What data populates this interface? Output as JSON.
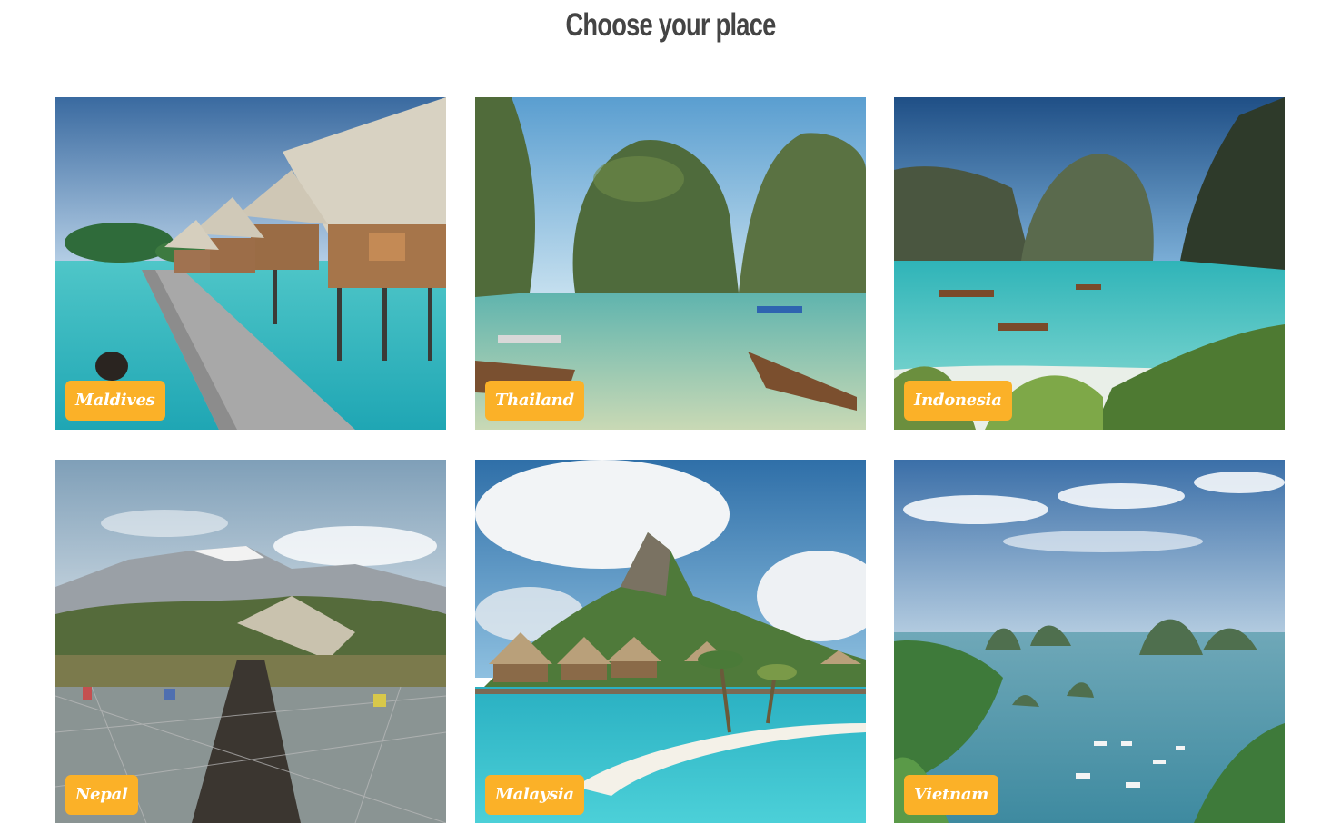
{
  "heading": "Choose your place",
  "colors": {
    "label_background": "#fbb128",
    "label_text": "#ffffff",
    "heading": "#444444"
  },
  "places": [
    {
      "name": "Maldives",
      "scene": "overwater-bungalows-boardwalk"
    },
    {
      "name": "Thailand",
      "scene": "limestone-cliffs-longtail-boats"
    },
    {
      "name": "Indonesia",
      "scene": "turquoise-bay-cliffs-boats"
    },
    {
      "name": "Nepal",
      "scene": "mountains-suspension-bridge"
    },
    {
      "name": "Malaysia",
      "scene": "mountain-overwater-villas-beach"
    },
    {
      "name": "Vietnam",
      "scene": "bay-islands-cruise-boats"
    }
  ]
}
